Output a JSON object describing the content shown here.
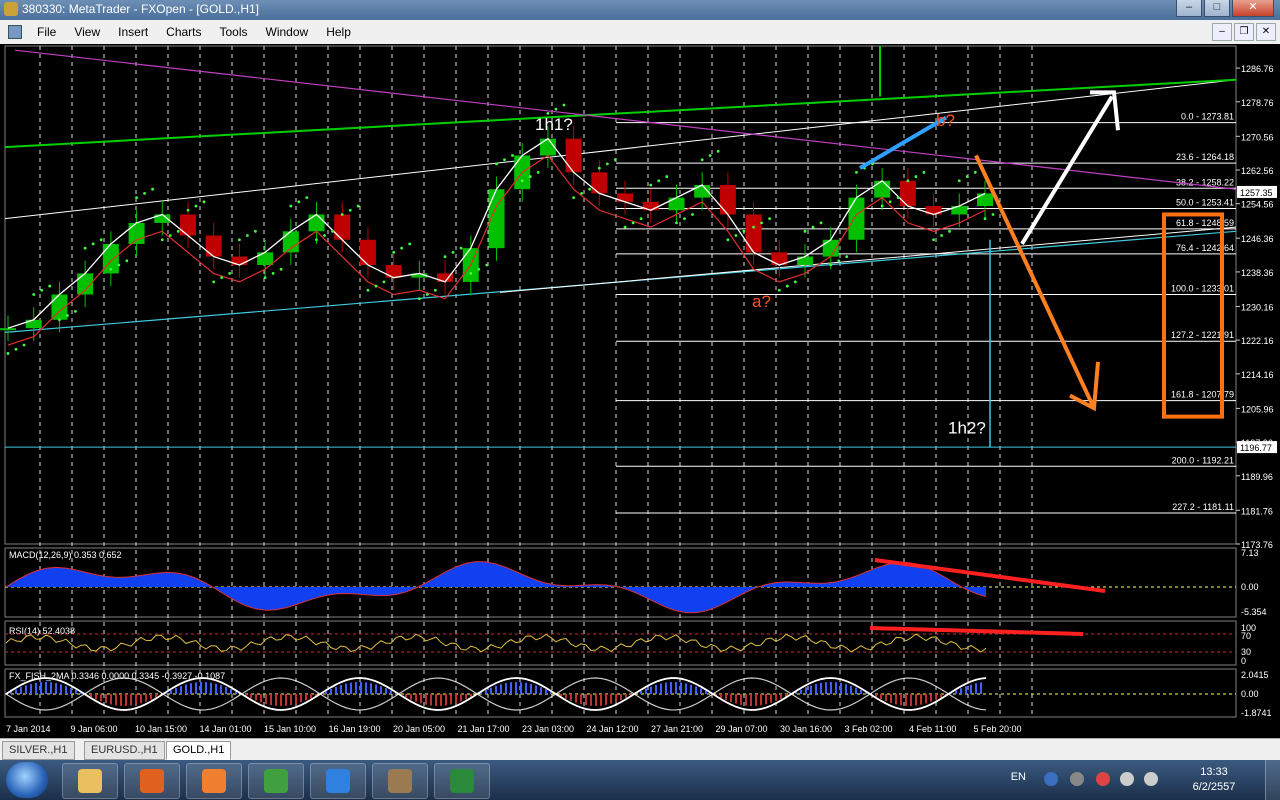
{
  "window": {
    "title": "380330: MetaTrader - FXOpen - [GOLD.,H1]"
  },
  "menu": {
    "items": [
      "File",
      "View",
      "Insert",
      "Charts",
      "Tools",
      "Window",
      "Help"
    ]
  },
  "colors": {
    "bull_candle": "#00c000",
    "bear_candle": "#c00000",
    "grid": "#ffffff",
    "fib_lines": "#ffffff",
    "channel_upper": "#00d000",
    "trendline_magenta": "#c040c0",
    "support": "#40c8e0",
    "arrow_orange": "#ff8020",
    "arrow_white": "#ffffff",
    "annotation_orange": "#ff5020",
    "annotation_white": "#ffffff",
    "blue_line": "#30a0ff",
    "divergence_red": "#ff2020",
    "box_orange": "#ff7010"
  },
  "chart_data": {
    "type": "candlestick",
    "title": "GOLD.,H1",
    "ylim": [
      1173.76,
      1292
    ],
    "price_axis_labels": [
      "1286.76",
      "1278.76",
      "1270.56",
      "1262.56",
      "1254.56",
      "1246.36",
      "1238.36",
      "1230.16",
      "1222.16",
      "1214.16",
      "1205.96",
      "1197.96",
      "1189.96",
      "1181.76",
      "1173.76"
    ],
    "current_price_label": "1257.35",
    "marker_price_label": "1196.77",
    "time_labels": [
      "7 Jan 2014",
      "9 Jan 06:00",
      "10 Jan 15:00",
      "14 Jan 01:00",
      "15 Jan 10:00",
      "16 Jan 19:00",
      "20 Jan 05:00",
      "21 Jan 17:00",
      "23 Jan 03:00",
      "24 Jan 12:00",
      "27 Jan 21:00",
      "29 Jan 07:00",
      "30 Jan 16:00",
      "3 Feb 02:00",
      "4 Feb 11:00",
      "5 Feb 20:00"
    ],
    "close_approx": [
      1225,
      1227,
      1233,
      1238,
      1245,
      1250,
      1252,
      1247,
      1242,
      1240,
      1243,
      1248,
      1252,
      1246,
      1240,
      1237,
      1238,
      1236,
      1244,
      1258,
      1266,
      1270,
      1262,
      1257,
      1255,
      1253,
      1256,
      1259,
      1252,
      1243,
      1240,
      1242,
      1246,
      1256,
      1260,
      1254,
      1252,
      1254,
      1257
    ],
    "fib_levels": [
      {
        "label": "0.0 - 1273.81",
        "price": 1273.81
      },
      {
        "label": "23.6 - 1264.18",
        "price": 1264.18
      },
      {
        "label": "38.2 - 1258.22",
        "price": 1258.22
      },
      {
        "label": "50.0 - 1253.41",
        "price": 1253.41
      },
      {
        "label": "61.8 - 1248.59",
        "price": 1248.59
      },
      {
        "label": "76.4 - 1242.64",
        "price": 1242.64
      },
      {
        "label": "100.0 - 1233.01",
        "price": 1233.01
      },
      {
        "label": "127.2 - 1221.91",
        "price": 1221.91
      },
      {
        "label": "161.8 - 1207.79",
        "price": 1207.79
      },
      {
        "label": "200.0 - 1192.21",
        "price": 1192.21
      },
      {
        "label": "227.2 - 1181.11",
        "price": 1181.11
      }
    ],
    "annotations": [
      "1h1?",
      "a?",
      "b?",
      "1h2?"
    ],
    "indicators": [
      {
        "name": "MACD(12,26,9) 0.353 0.652",
        "axis": [
          "7.13",
          "0.00",
          "-5.354"
        ]
      },
      {
        "name": "RSI(14) 52.4038",
        "axis": [
          "100",
          "70",
          "30",
          "0"
        ]
      },
      {
        "name": "FX_FISH_2MA 0.3346 0.0000 0.3345 -0.3927 -0.1087",
        "axis": [
          "2.0415",
          "0.00",
          "-1.8741"
        ]
      }
    ]
  },
  "tabs": [
    "SILVER.,H1",
    "EURUSD.,H1",
    "GOLD.,H1"
  ],
  "taskbar": {
    "apps": [
      "file-explorer-icon",
      "media-player-icon",
      "firefox-icon",
      "chrome-icon",
      "internet-explorer-icon",
      "metatrader-icon",
      "excel-icon"
    ]
  },
  "tray": {
    "lang": "EN",
    "time": "13:33",
    "date": "6/2/2557"
  }
}
